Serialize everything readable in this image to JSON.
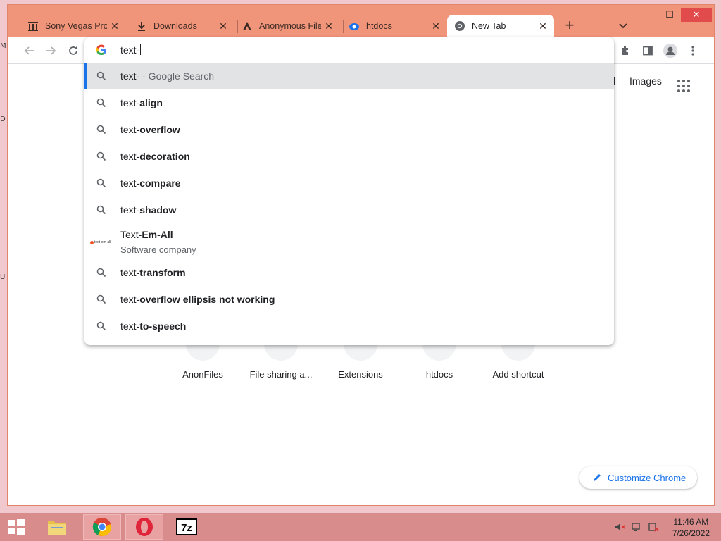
{
  "browser": {
    "tabs": [
      {
        "label": "Sony Vegas Pro",
        "icon": "building-icon",
        "active": false
      },
      {
        "label": "Downloads",
        "icon": "download-icon",
        "active": false
      },
      {
        "label": "Anonymous File",
        "icon": "anonfiles-icon",
        "active": false
      },
      {
        "label": "htdocs",
        "icon": "cloud-icon",
        "active": false
      },
      {
        "label": "New Tab",
        "icon": "chrome-icon",
        "active": true
      }
    ],
    "new_tab_symbol": "+",
    "window_controls": {
      "minimize": "—",
      "maximize": "☐",
      "close": "✕"
    }
  },
  "omnibox": {
    "value": "text-",
    "suggestions": [
      {
        "prefix": "text-",
        "bold": "",
        "suffix": " - Google Search",
        "type": "search",
        "selected": true
      },
      {
        "prefix": "text-",
        "bold": "align",
        "type": "search"
      },
      {
        "prefix": "text-",
        "bold": "overflow",
        "type": "search"
      },
      {
        "prefix": "text-",
        "bold": "decoration",
        "type": "search"
      },
      {
        "prefix": "text-",
        "bold": "compare",
        "type": "search"
      },
      {
        "prefix": "text-",
        "bold": "shadow",
        "type": "search"
      },
      {
        "prefix": "Text-",
        "bold": "Em-All",
        "subtitle": "Software company",
        "type": "entity",
        "logo_text": "text-em-all"
      },
      {
        "prefix": "text-",
        "bold": "transform",
        "type": "search"
      },
      {
        "prefix": "text-",
        "bold": "overflow ellipsis not working",
        "type": "search"
      },
      {
        "prefix": "text-",
        "bold": "to-speech",
        "type": "search"
      }
    ]
  },
  "page": {
    "top_links": {
      "gmail_partial": "il",
      "images": "Images"
    },
    "shortcuts": [
      {
        "label": "AnonFiles"
      },
      {
        "label": "File sharing a..."
      },
      {
        "label": "Extensions"
      },
      {
        "label": "htdocs"
      },
      {
        "label": "Add shortcut"
      }
    ],
    "customize_label": "Customize Chrome"
  },
  "taskbar": {
    "time": "11:46 AM",
    "date": "7/26/2022",
    "apps": [
      "start",
      "file-explorer",
      "chrome",
      "opera",
      "7zip"
    ]
  },
  "colors": {
    "accent": "#1a73e8",
    "frame": "#f0947a",
    "taskbar": "#d98c8c"
  }
}
